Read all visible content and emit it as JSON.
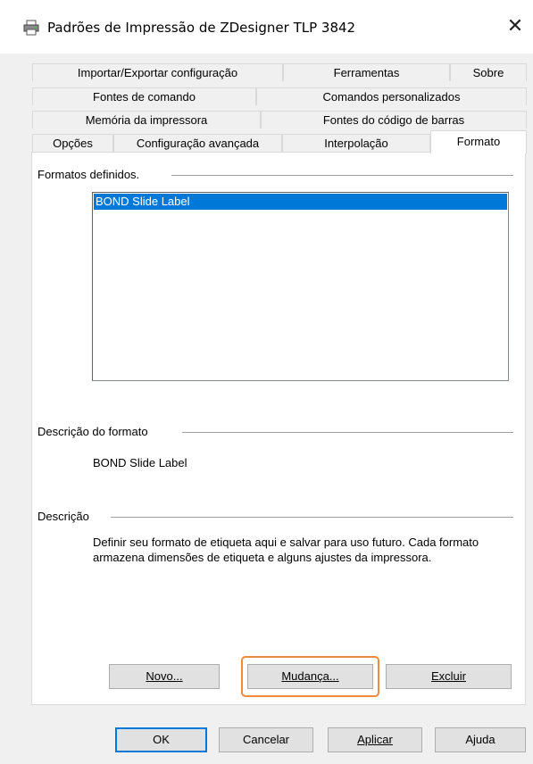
{
  "window": {
    "title": "Padrões de Impressão de ZDesigner TLP 3842",
    "close_glyph": "✕",
    "icon": "printer-icon"
  },
  "tabs": {
    "row1": [
      "Importar/Exportar configuração",
      "Ferramentas",
      "Sobre"
    ],
    "row2": [
      "Fontes de comando",
      "Comandos personalizados"
    ],
    "row3": [
      "Memória da impressora",
      "Fontes do código de barras"
    ],
    "row4": [
      "Opções",
      "Configuração avançada",
      "Interpolação",
      "Formato"
    ],
    "active": "Formato"
  },
  "formats": {
    "label": "Formatos definidos.",
    "items": [
      "BOND Slide Label"
    ],
    "selected_index": 0
  },
  "format_description": {
    "label": "Descrição do formato",
    "value": "BOND Slide Label"
  },
  "description": {
    "label": "Descrição",
    "text": "Definir seu formato de etiqueta aqui e salvar para uso futuro. Cada formato armazena dimensões de etiqueta e alguns ajustes da impressora."
  },
  "panel_buttons": {
    "new": "Novo...",
    "change": "Mudança...",
    "delete": "Excluir"
  },
  "dialog_buttons": {
    "ok": "OK",
    "cancel": "Cancelar",
    "apply": "Aplicar",
    "help": "Ajuda"
  },
  "colors": {
    "selection": "#0078d7",
    "highlight_ring": "#f08a3c"
  }
}
